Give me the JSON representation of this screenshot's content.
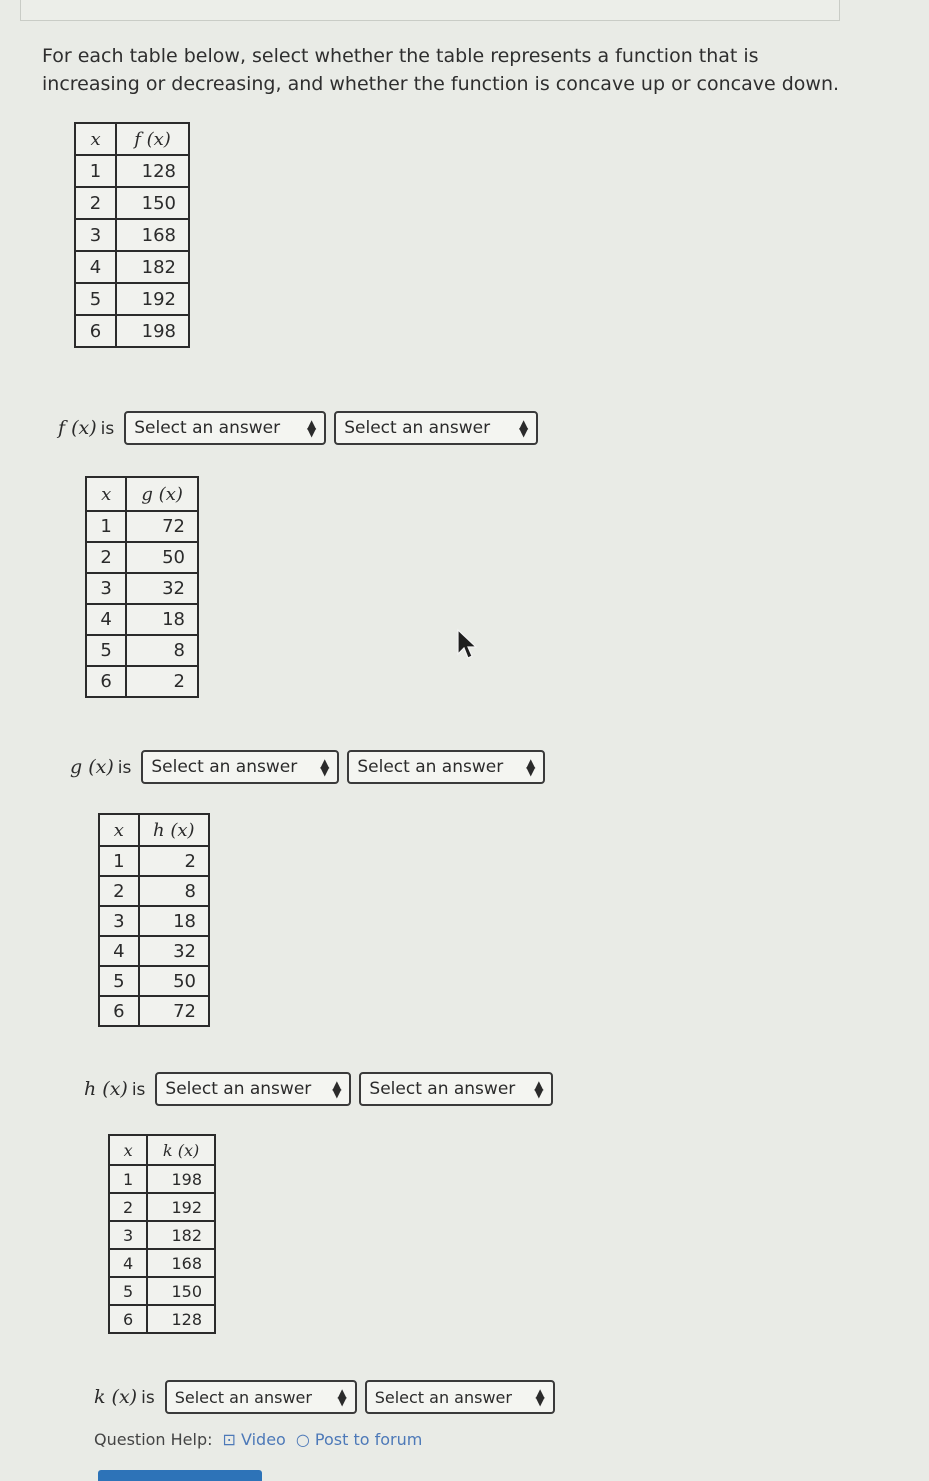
{
  "instructions": "For each table below, select whether the table represents a function that is increasing or decreasing, and whether the function is concave up or concave down.",
  "x_header": "x",
  "is_word": "is",
  "tables": [
    {
      "fn_header": "f (x)",
      "label": "f (x)",
      "rows": [
        [
          "1",
          "128"
        ],
        [
          "2",
          "150"
        ],
        [
          "3",
          "168"
        ],
        [
          "4",
          "182"
        ],
        [
          "5",
          "192"
        ],
        [
          "6",
          "198"
        ]
      ],
      "select1": "Select an answer",
      "select2": "Select an answer"
    },
    {
      "fn_header": "g (x)",
      "label": "g (x)",
      "rows": [
        [
          "1",
          "72"
        ],
        [
          "2",
          "50"
        ],
        [
          "3",
          "32"
        ],
        [
          "4",
          "18"
        ],
        [
          "5",
          "8"
        ],
        [
          "6",
          "2"
        ]
      ],
      "select1": "Select an answer",
      "select2": "Select an answer"
    },
    {
      "fn_header": "h (x)",
      "label": "h (x)",
      "rows": [
        [
          "1",
          "2"
        ],
        [
          "2",
          "8"
        ],
        [
          "3",
          "18"
        ],
        [
          "4",
          "32"
        ],
        [
          "5",
          "50"
        ],
        [
          "6",
          "72"
        ]
      ],
      "select1": "Select an answer",
      "select2": "Select an answer"
    },
    {
      "fn_header": "k (x)",
      "label": "k (x)",
      "rows": [
        [
          "1",
          "198"
        ],
        [
          "2",
          "192"
        ],
        [
          "3",
          "182"
        ],
        [
          "4",
          "168"
        ],
        [
          "5",
          "150"
        ],
        [
          "6",
          "128"
        ]
      ],
      "select1": "Select an answer",
      "select2": "Select an answer"
    }
  ],
  "help": {
    "label": "Question Help:",
    "video": "Video",
    "forum": "Post to forum"
  }
}
